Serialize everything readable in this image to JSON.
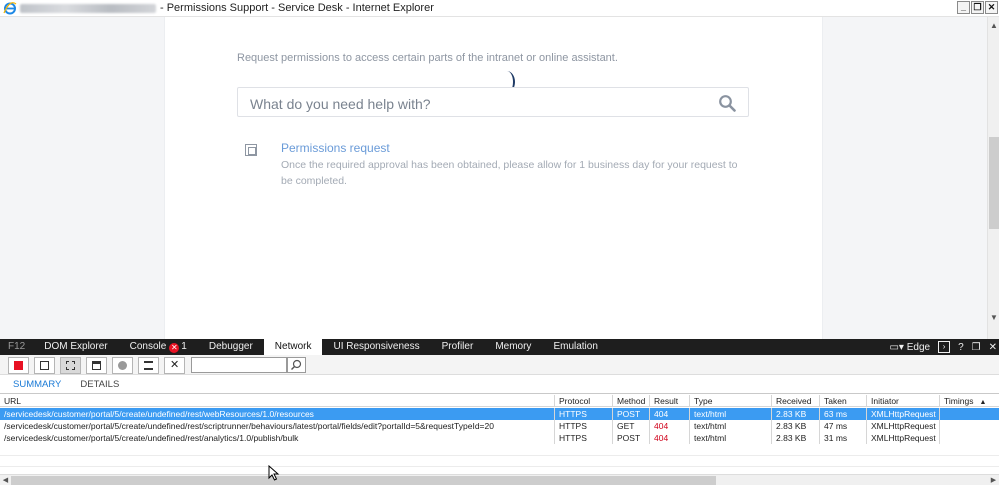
{
  "window": {
    "title": "- Permissions Support - Service Desk - Internet Explorer",
    "controls": [
      "_",
      "❐",
      "✕"
    ]
  },
  "page": {
    "intro": "Request permissions to access certain parts of the intranet or online assistant.",
    "search_placeholder": "What do you need help with?",
    "request_title": "Permissions request",
    "request_desc": "Once the required approval has been obtained, please allow for 1 business day for your request to be completed."
  },
  "devtools": {
    "tabs": [
      {
        "label": "F12"
      },
      {
        "label": "DOM Explorer"
      },
      {
        "label": "Console"
      },
      {
        "label": "Debugger"
      },
      {
        "label": "Network"
      },
      {
        "label": "UI Responsiveness"
      },
      {
        "label": "Profiler"
      },
      {
        "label": "Memory"
      },
      {
        "label": "Emulation"
      }
    ],
    "console_errors": "1",
    "active_tab": "Network",
    "mode": "Edge",
    "subtabs": [
      "SUMMARY",
      "DETAILS"
    ],
    "columns": [
      "URL",
      "Protocol",
      "Method",
      "Result",
      "Type",
      "Received",
      "Taken",
      "Initiator",
      "Timings"
    ],
    "rows": [
      {
        "url": "/servicedesk/customer/portal/5/create/undefined/rest/webResources/1.0/resources",
        "protocol": "HTTPS",
        "method": "POST",
        "result": "404",
        "type": "text/html",
        "received": "2.83 KB",
        "taken": "63 ms",
        "initiator": "XMLHttpRequest"
      },
      {
        "url": "/servicedesk/customer/portal/5/create/undefined/rest/scriptrunner/behaviours/latest/portal/fields/edit?portalId=5&requestTypeId=20",
        "protocol": "HTTPS",
        "method": "GET",
        "result": "404",
        "type": "text/html",
        "received": "2.83 KB",
        "taken": "47 ms",
        "initiator": "XMLHttpRequest"
      },
      {
        "url": "/servicedesk/customer/portal/5/create/undefined/rest/analytics/1.0/publish/bulk",
        "protocol": "HTTPS",
        "method": "POST",
        "result": "404",
        "type": "text/html",
        "received": "2.83 KB",
        "taken": "31 ms",
        "initiator": "XMLHttpRequest"
      }
    ]
  }
}
